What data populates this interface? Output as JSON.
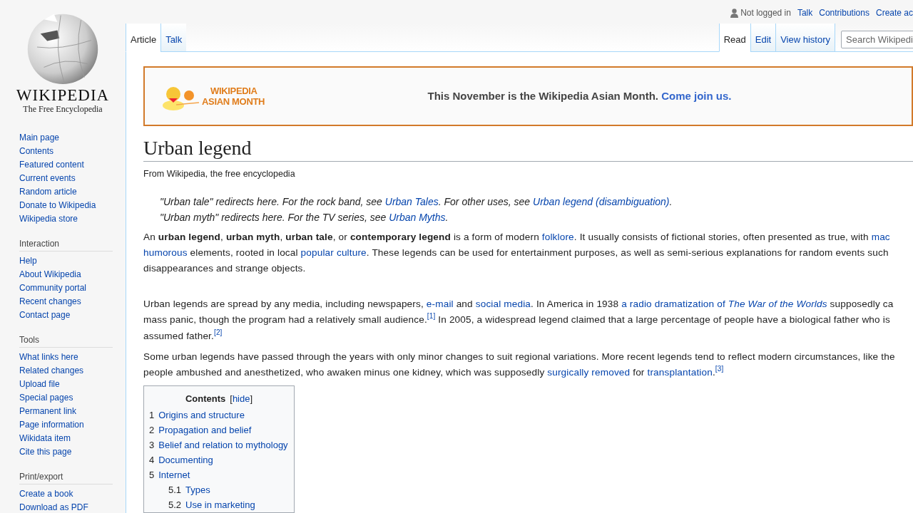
{
  "logo": {
    "wordmark": "WIKIPEDIA",
    "tagline": "The Free Encyclopedia"
  },
  "personal": {
    "status": "Not logged in",
    "links": [
      "Talk",
      "Contributions",
      "Create ac"
    ]
  },
  "left_tabs": [
    {
      "label": "Article",
      "selected": true
    },
    {
      "label": "Talk",
      "selected": false
    }
  ],
  "right_tabs": [
    {
      "label": "Read",
      "selected": true
    },
    {
      "label": "Edit",
      "selected": false
    },
    {
      "label": "View history",
      "selected": false
    }
  ],
  "search": {
    "placeholder": "Search Wikipedi"
  },
  "sidebar": {
    "main": [
      "Main page",
      "Contents",
      "Featured content",
      "Current events",
      "Random article",
      "Donate to Wikipedia",
      "Wikipedia store"
    ],
    "sections": [
      {
        "heading": "Interaction",
        "items": [
          "Help",
          "About Wikipedia",
          "Community portal",
          "Recent changes",
          "Contact page"
        ]
      },
      {
        "heading": "Tools",
        "items": [
          "What links here",
          "Related changes",
          "Upload file",
          "Special pages",
          "Permanent link",
          "Page information",
          "Wikidata item",
          "Cite this page"
        ]
      },
      {
        "heading": "Print/export",
        "items": [
          "Create a book",
          "Download as PDF"
        ]
      }
    ]
  },
  "banner": {
    "logo_lines": [
      "WIKIPEDIA",
      "ASIAN MONTH"
    ],
    "text": "This November is the Wikipedia Asian Month.",
    "link": "Come join us."
  },
  "title": "Urban legend",
  "subtitle": "From Wikipedia, the free encyclopedia",
  "hatnotes": [
    [
      {
        "kind": "text",
        "text": "\"Urban tale\" redirects here. For the rock band, see "
      },
      {
        "kind": "link",
        "text": "Urban Tales"
      },
      {
        "kind": "text",
        "text": ". For other uses, see "
      },
      {
        "kind": "link",
        "text": "Urban legend (disambiguation)"
      },
      {
        "kind": "text",
        "text": "."
      }
    ],
    [
      {
        "kind": "text",
        "text": "\"Urban myth\" redirects here. For the TV series, see "
      },
      {
        "kind": "link",
        "text": "Urban Myths"
      },
      {
        "kind": "text",
        "text": "."
      }
    ]
  ],
  "paragraphs": [
    {
      "lines": [
        [
          {
            "kind": "text",
            "text": "An "
          },
          {
            "kind": "bold",
            "text": "urban legend"
          },
          {
            "kind": "text",
            "text": ", "
          },
          {
            "kind": "bold",
            "text": "urban myth"
          },
          {
            "kind": "text",
            "text": ", "
          },
          {
            "kind": "bold",
            "text": "urban tale"
          },
          {
            "kind": "text",
            "text": ", or "
          },
          {
            "kind": "bold",
            "text": "contemporary legend"
          },
          {
            "kind": "text",
            "text": " is a form of modern "
          },
          {
            "kind": "link",
            "text": "folklore"
          },
          {
            "kind": "text",
            "text": ". It usually consists of fictional stories, often presented as true, with "
          },
          {
            "kind": "link",
            "text": "mac"
          }
        ],
        [
          {
            "kind": "link",
            "text": "humorous"
          },
          {
            "kind": "text",
            "text": " elements, rooted in local "
          },
          {
            "kind": "link",
            "text": "popular culture"
          },
          {
            "kind": "text",
            "text": ". These legends can be used for entertainment purposes, as well as semi-serious explanations for random events such"
          }
        ],
        [
          {
            "kind": "text",
            "text": "disappearances and strange objects."
          }
        ]
      ]
    },
    {
      "lines": [
        [
          {
            "kind": "text",
            "text": "Urban legends are spread by any media, including newspapers, "
          },
          {
            "kind": "link",
            "text": "e-mail"
          },
          {
            "kind": "text",
            "text": " and "
          },
          {
            "kind": "link",
            "text": "social media"
          },
          {
            "kind": "text",
            "text": ". In America in 1938 "
          },
          {
            "kind": "link",
            "text": "a radio dramatization of *The War of the Worlds*"
          },
          {
            "kind": "text",
            "text": " supposedly ca"
          }
        ],
        [
          {
            "kind": "text",
            "text": "mass panic, though the program had a relatively small audience."
          },
          {
            "kind": "ref",
            "text": "[1]"
          },
          {
            "kind": "text",
            "text": " In 2005, a widespread legend claimed that a large percentage of people have a biological father who is"
          }
        ],
        [
          {
            "kind": "text",
            "text": "assumed father."
          },
          {
            "kind": "ref",
            "text": "[2]"
          }
        ]
      ]
    },
    {
      "lines": [
        [
          {
            "kind": "text",
            "text": "Some urban legends have passed through the years with only minor changes to suit regional variations. More recent legends tend to reflect modern circumstances, like the"
          }
        ],
        [
          {
            "kind": "text",
            "text": "people ambushed and anesthetized, who awaken minus one kidney, which was supposedly "
          },
          {
            "kind": "link",
            "text": "surgically removed"
          },
          {
            "kind": "text",
            "text": " for "
          },
          {
            "kind": "link",
            "text": "transplantation",
            "after": "."
          },
          {
            "kind": "ref",
            "text": "[3]"
          }
        ]
      ]
    }
  ],
  "toc": {
    "title": "Contents",
    "toggle": {
      "open": "[",
      "label": "hide",
      "close": "]"
    },
    "items": [
      {
        "number": "1",
        "label": "Origins and structure"
      },
      {
        "number": "2",
        "label": "Propagation and belief"
      },
      {
        "number": "3",
        "label": "Belief and relation to mythology"
      },
      {
        "number": "4",
        "label": "Documenting"
      },
      {
        "number": "5",
        "label": "Internet",
        "children": [
          {
            "number": "5.1",
            "label": "Types"
          },
          {
            "number": "5.2",
            "label": "Use in marketing"
          }
        ]
      }
    ]
  }
}
